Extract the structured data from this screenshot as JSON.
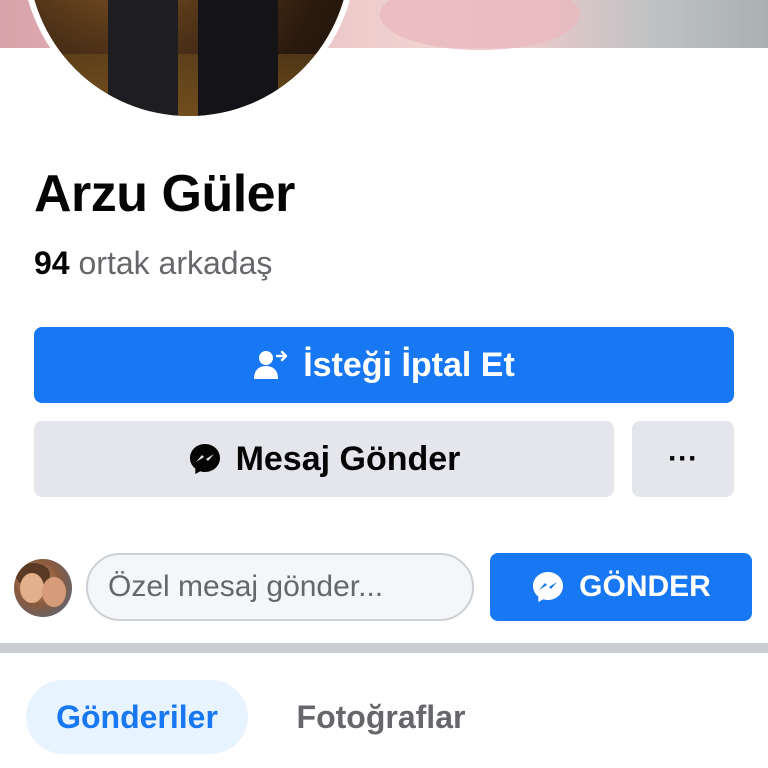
{
  "profile": {
    "name": "Arzu Güler",
    "mutual_count": "94",
    "mutual_label": "ortak arkadaş"
  },
  "actions": {
    "cancel_request_label": "İsteği İptal Et",
    "send_message_label": "Mesaj Gönder",
    "more_label": "···"
  },
  "message": {
    "placeholder": "Özel mesaj gönder...",
    "send_label": "GÖNDER"
  },
  "tabs": [
    {
      "label": "Gönderiler",
      "active": true
    },
    {
      "label": "Fotoğraflar",
      "active": false
    }
  ],
  "colors": {
    "accent": "#1877f2",
    "secondary_bg": "#e4e6eb",
    "active_tab_bg": "#e7f3ff",
    "muted_text": "#65676b"
  },
  "icons": {
    "cancel_request": "user-arrow-icon",
    "messenger": "messenger-icon",
    "more": "more-dots-icon"
  }
}
